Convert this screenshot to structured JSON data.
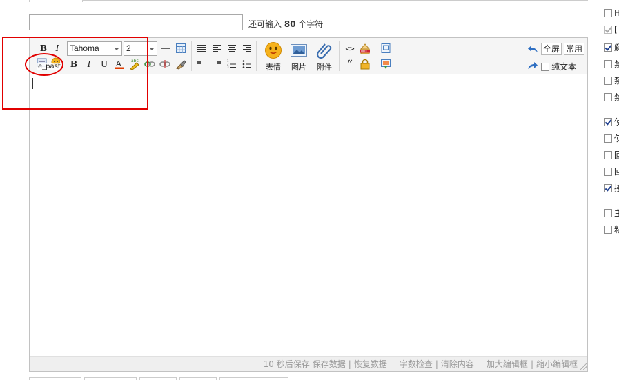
{
  "subject": {
    "value": "",
    "remaining_prefix": "还可输入",
    "remaining_count": "80",
    "remaining_suffix": "个字符"
  },
  "toolbar": {
    "row1": {
      "bold": "B",
      "italic": "I",
      "font_family": "Tahoma",
      "font_size": "2"
    },
    "row2": {
      "paste_icon_text": "e_past",
      "bold": "B",
      "italic": "I",
      "underline": "U",
      "highlight_icon_text": "abc"
    },
    "quote_glyph": "“",
    "code_glyph": "<>",
    "free_badge": "FREE",
    "large": {
      "smiley": "表情",
      "image": "图片",
      "attach": "附件"
    },
    "fullscreen": "全屏",
    "common": "常用",
    "plain_text": "纯文本",
    "plain_text_checked": false
  },
  "statusbar": {
    "autosave": "10 秒后保存",
    "save": "保存数据",
    "restore": "恢复数据",
    "wordcheck": "字数检查",
    "clear": "清除内容",
    "enlarge": "加大编辑框",
    "shrink": "缩小编辑框",
    "divider": "|"
  },
  "right_options": [
    {
      "label": "H",
      "checked": false,
      "disabled": false
    },
    {
      "label": "[",
      "checked": true,
      "disabled": true
    },
    {
      "label": "解",
      "checked": true,
      "disabled": false
    },
    {
      "label": "禁",
      "checked": false,
      "disabled": false
    },
    {
      "label": "禁",
      "checked": false,
      "disabled": false
    },
    {
      "label": "禁",
      "checked": false,
      "disabled": false
    },
    {
      "label": "使",
      "checked": true,
      "disabled": false
    },
    {
      "label": "使",
      "checked": false,
      "disabled": false
    },
    {
      "label": "回",
      "checked": false,
      "disabled": false
    },
    {
      "label": "回",
      "checked": false,
      "disabled": false
    },
    {
      "label": "接",
      "checked": true,
      "disabled": false
    },
    {
      "label": "主",
      "checked": false,
      "disabled": false
    },
    {
      "label": "粘",
      "checked": false,
      "disabled": false
    }
  ],
  "colors": {
    "annotation": "#e10000",
    "accent_blue": "#1f5fb0",
    "statusbar_text": "#9a9a9a"
  }
}
